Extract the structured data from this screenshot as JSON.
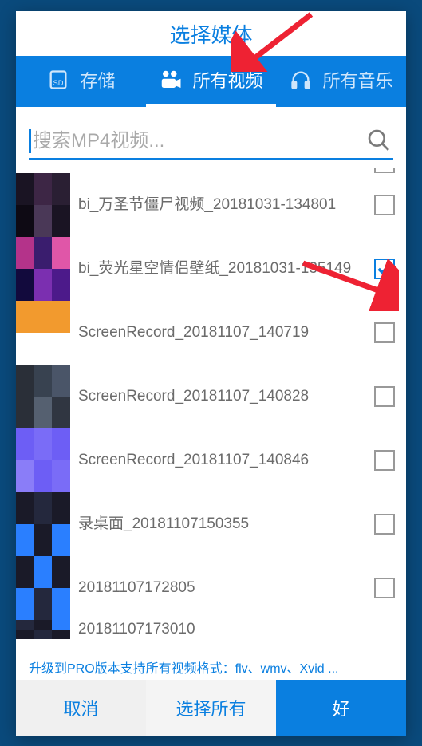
{
  "title": "选择媒体",
  "tabs": {
    "storage": "存储",
    "video": "所有视频",
    "music": "所有音乐"
  },
  "search": {
    "placeholder": "搜索MP4视频..."
  },
  "items": [
    {
      "name": "bi_万圣节僵尸视频_20181031-134801",
      "checked": false,
      "thumbStyle": "dark"
    },
    {
      "name": "bi_荧光星空情侣壁纸_20181031-135149",
      "checked": true,
      "thumbStyle": "galaxy"
    },
    {
      "name": "ScreenRecord_20181107_140719",
      "checked": false,
      "thumbStyle": "orange"
    },
    {
      "name": "ScreenRecord_20181107_140828",
      "checked": false,
      "thumbStyle": "desk"
    },
    {
      "name": "ScreenRecord_20181107_140846",
      "checked": false,
      "thumbStyle": "purple"
    },
    {
      "name": "录桌面_20181107150355",
      "checked": false,
      "thumbStyle": "blue"
    },
    {
      "name": "20181107172805",
      "checked": false,
      "thumbStyle": "blue2"
    },
    {
      "name": "20181107173010",
      "checked": false,
      "thumbStyle": "cut"
    }
  ],
  "promo": "升级到PRO版本支持所有视频格式：flv、wmv、Xvid ...",
  "footer": {
    "cancel": "取消",
    "selectall": "选择所有",
    "ok": "好"
  }
}
